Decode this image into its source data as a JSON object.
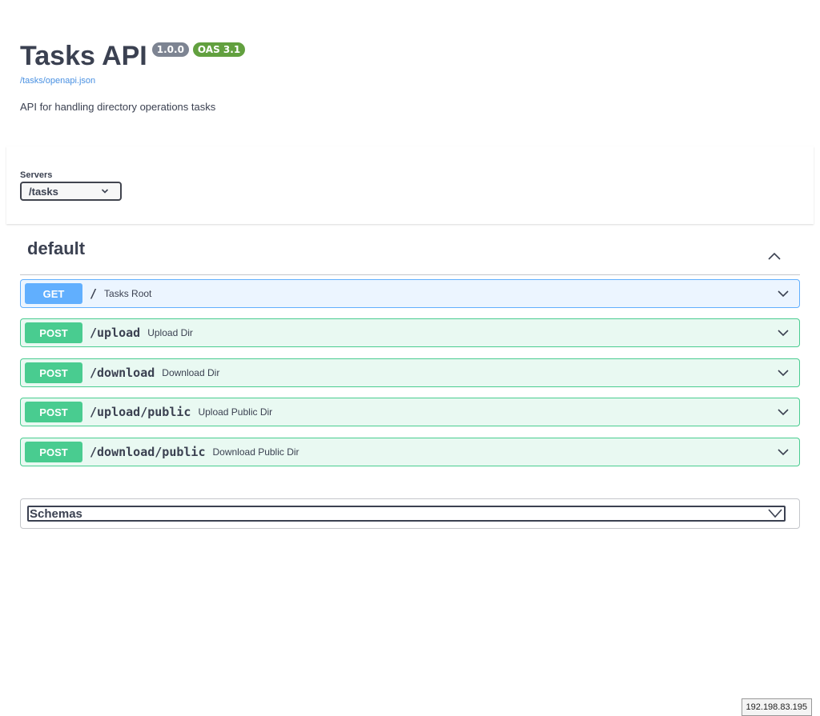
{
  "info": {
    "title": "Tasks API",
    "version_badge": "1.0.0",
    "oas_badge": "OAS 3.1",
    "spec_link": "/tasks/openapi.json",
    "description": "API for handling directory operations tasks"
  },
  "servers": {
    "label": "Servers",
    "selected": "/tasks"
  },
  "tag": {
    "name": "default",
    "expanded": true
  },
  "operations": [
    {
      "method": "GET",
      "path": "/",
      "summary": "Tasks Root"
    },
    {
      "method": "POST",
      "path": "/upload",
      "summary": "Upload Dir"
    },
    {
      "method": "POST",
      "path": "/download",
      "summary": "Download Dir"
    },
    {
      "method": "POST",
      "path": "/upload/public",
      "summary": "Upload Public Dir"
    },
    {
      "method": "POST",
      "path": "/download/public",
      "summary": "Download Public Dir"
    }
  ],
  "schemas": {
    "title": "Schemas"
  },
  "footer": {
    "ip": "192.198.83.195"
  },
  "colors": {
    "get": "#61affe",
    "post": "#49cc90",
    "version_badge": "#7d8492",
    "oas_badge": "#62a03f",
    "link": "#4990e2",
    "text": "#3b4151"
  },
  "icons": {
    "select_chevron": "chevron-down-icon",
    "tag_toggle": "chevron-up-icon",
    "operation_toggle": "chevron-down-icon",
    "schemas_toggle": "chevron-down-icon"
  }
}
